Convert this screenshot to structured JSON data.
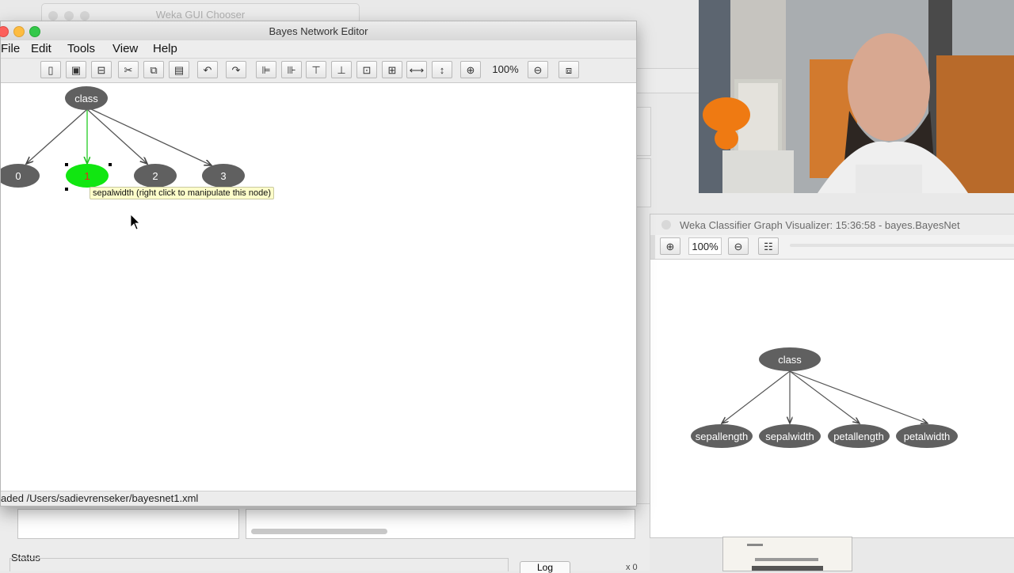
{
  "chooser": {
    "title": "Weka GUI Chooser"
  },
  "editor": {
    "title": "Bayes Network Editor",
    "menu": [
      "File",
      "Edit",
      "Tools",
      "View",
      "Help"
    ],
    "zoom": "100%",
    "nodes": [
      "class",
      "0",
      "1",
      "2",
      "3"
    ],
    "tooltip": "sepalwidth (right click to manipulate this node)",
    "status": "aded /Users/sadievrenseker/bayesnet1.xml"
  },
  "visualizer": {
    "title": "Weka Classifier Graph Visualizer: 15:36:58 - bayes.BayesNet",
    "zoom": "100%",
    "nodes": [
      "class",
      "sepallength",
      "sepalwidth",
      "petallength",
      "petalwidth"
    ]
  },
  "background": {
    "status_label": "Status",
    "log_button": "Log",
    "count": "x 0"
  },
  "colors": {
    "node": "#606060",
    "selected_node": "#11e611",
    "tooltip_bg": "#fdfdca"
  }
}
